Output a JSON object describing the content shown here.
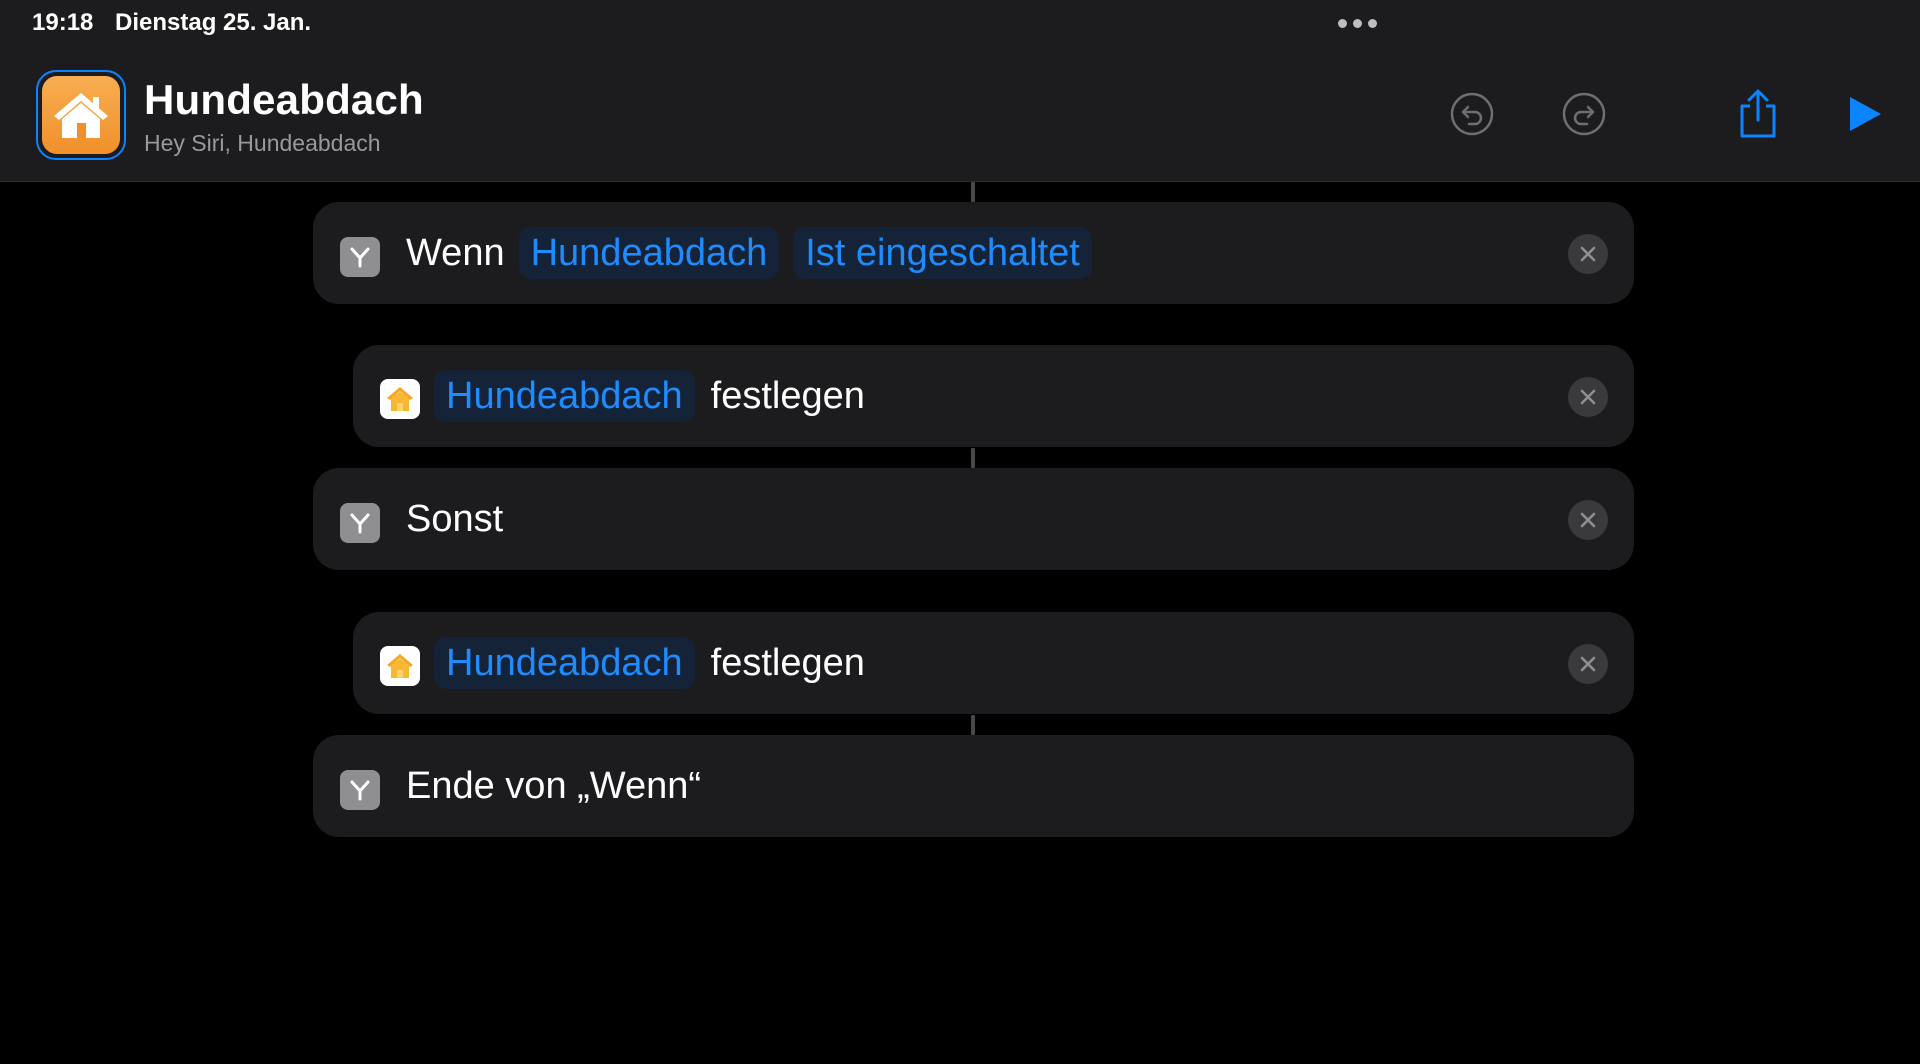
{
  "status_bar": {
    "time": "19:18",
    "date": "Dienstag 25. Jan."
  },
  "header": {
    "title": "Hundeabdach",
    "subtitle": "Hey Siri, Hundeabdach",
    "icon": "house-icon",
    "accent_color": "#0a84ff",
    "icon_color": "#f29a33"
  },
  "toolbar": {
    "undo_icon": "undo-icon",
    "redo_icon": "redo-icon",
    "share_icon": "share-icon",
    "run_icon": "play-icon"
  },
  "actions": [
    {
      "type": "if",
      "keyword": "Wenn",
      "tokens": [
        "Hundeabdach",
        "Ist eingeschaltet"
      ],
      "icon": "scripting-branch-icon"
    },
    {
      "type": "set-home",
      "tokens": [
        "Hundeabdach"
      ],
      "after": "festlegen",
      "icon": "home-app-icon"
    },
    {
      "type": "otherwise",
      "keyword": "Sonst",
      "icon": "scripting-branch-icon"
    },
    {
      "type": "set-home",
      "tokens": [
        "Hundeabdach"
      ],
      "after": "festlegen",
      "icon": "home-app-icon"
    },
    {
      "type": "end-if",
      "keyword": "Ende von „Wenn“",
      "icon": "scripting-branch-icon"
    }
  ],
  "colors": {
    "background": "#000000",
    "card": "#1c1c1e",
    "token_text": "#1e8cff",
    "token_bg": "#142337",
    "icon_gray": "#8e8e93"
  }
}
